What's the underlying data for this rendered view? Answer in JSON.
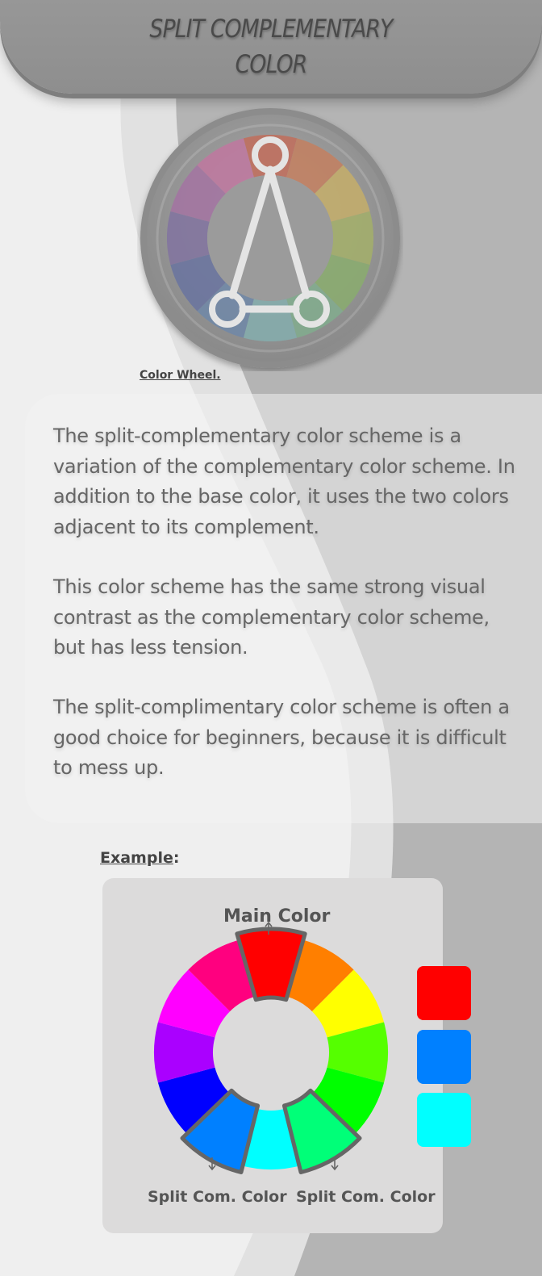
{
  "header": {
    "title": "SPLIT COMPLEMENTARY COLOR"
  },
  "figure": {
    "caption": "Color Wheel."
  },
  "description": {
    "paragraphs": [
      "The split-complementary color scheme is a variation of the complementary color scheme. In addition to the base color, it uses the two colors adjacent to its complement.",
      "This color scheme has the same strong visual contrast as the complementary color scheme, but has less tension.",
      "The split-complimentary color scheme is often a good choice for beginners, because it is difficult to mess up."
    ]
  },
  "example": {
    "label": "Example",
    "main_color_label": "Main Color",
    "split_label_left": "Split Com. Color",
    "split_label_right": "Split Com. Color",
    "wheel_colors": [
      "#ff0000",
      "#ff7f00",
      "#ffff00",
      "#55ff00",
      "#00ff00",
      "#00ff78",
      "#00ffff",
      "#0080ff",
      "#0000ff",
      "#aa00ff",
      "#ff00ff",
      "#ff007f"
    ],
    "highlighted": [
      0,
      5,
      7
    ],
    "swatches": [
      "#ff0000",
      "#0080ff",
      "#00ffff"
    ]
  },
  "colors": {
    "header": "#939393",
    "background": "#efefef",
    "panel": "#dcdbdb",
    "text": "#666666"
  }
}
